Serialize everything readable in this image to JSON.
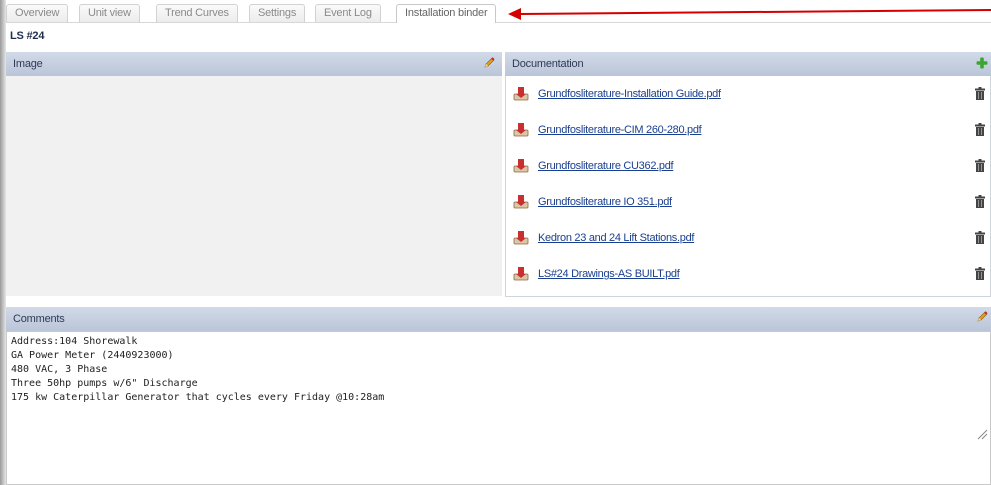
{
  "tabs": [
    {
      "label": "Overview",
      "active": false
    },
    {
      "label": "Unit view",
      "active": false
    },
    {
      "label": "Trend Curves",
      "active": false
    },
    {
      "label": "Settings",
      "active": false
    },
    {
      "label": "Event Log",
      "active": false
    },
    {
      "label": "Installation binder",
      "active": true
    }
  ],
  "page_title": "LS #24",
  "image_panel": {
    "title": "Image",
    "edit_icon": "pencil-icon"
  },
  "documentation": {
    "title": "Documentation",
    "add_icon": "plus-icon",
    "files": [
      {
        "name": "Grundfosliterature-Installation Guide.pdf"
      },
      {
        "name": "Grundfosliterature-CIM 260-280.pdf"
      },
      {
        "name": "Grundfosliterature CU362.pdf"
      },
      {
        "name": "Grundfosliterature IO 351.pdf"
      },
      {
        "name": "Kedron 23 and 24 Lift Stations.pdf"
      },
      {
        "name": "LS#24 Drawings-AS BUILT.pdf"
      }
    ]
  },
  "comments": {
    "title": "Comments",
    "text": "Address:104 Shorewalk\nGA Power Meter (2440923000)\n480 VAC, 3 Phase\nThree 50hp pumps w/6\" Discharge\n175 kw Caterpillar Generator that cycles every Friday @10:28am"
  },
  "colors": {
    "header_bg": "#c3cde0",
    "link": "#1a3f8f",
    "annotation_arrow": "#d40000",
    "add_green": "#3aa52f"
  }
}
